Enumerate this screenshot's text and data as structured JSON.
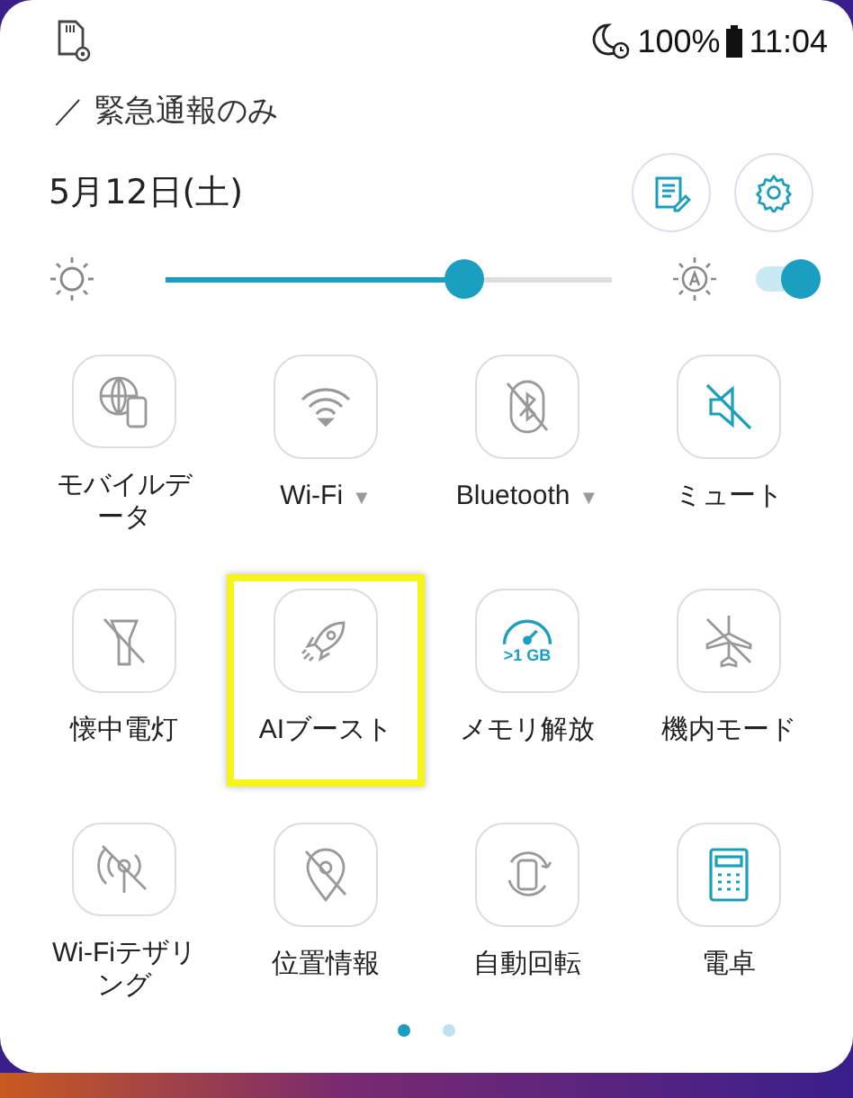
{
  "status_bar": {
    "battery": "100%",
    "time": "11:04"
  },
  "carrier": "／ 緊急通報のみ",
  "date": "5月12日(土)",
  "brightness": {
    "level": 0.67,
    "auto": true
  },
  "tiles": [
    {
      "label": "モバイルデータ",
      "active": false,
      "highlighted": false
    },
    {
      "label": "Wi-Fi",
      "caret": "▼",
      "active": false,
      "highlighted": false
    },
    {
      "label": "Bluetooth",
      "caret": "▼",
      "active": false,
      "highlighted": false
    },
    {
      "label": "ミュート",
      "active": true,
      "highlighted": false
    },
    {
      "label": "懐中電灯",
      "active": false,
      "highlighted": false
    },
    {
      "label": "AIブースト",
      "active": false,
      "highlighted": true
    },
    {
      "label": "メモリ解放",
      "icon_text": ">1 GB",
      "active": true,
      "highlighted": false
    },
    {
      "label": "機内モード",
      "active": false,
      "highlighted": false
    },
    {
      "label": "Wi-Fiテザリング",
      "active": false,
      "highlighted": false
    },
    {
      "label": "位置情報",
      "active": false,
      "highlighted": false
    },
    {
      "label": "自動回転",
      "active": false,
      "highlighted": false
    },
    {
      "label": "電卓",
      "active": true,
      "highlighted": false
    }
  ],
  "pages": [
    {
      "selected": true
    },
    {
      "selected": false
    }
  ]
}
